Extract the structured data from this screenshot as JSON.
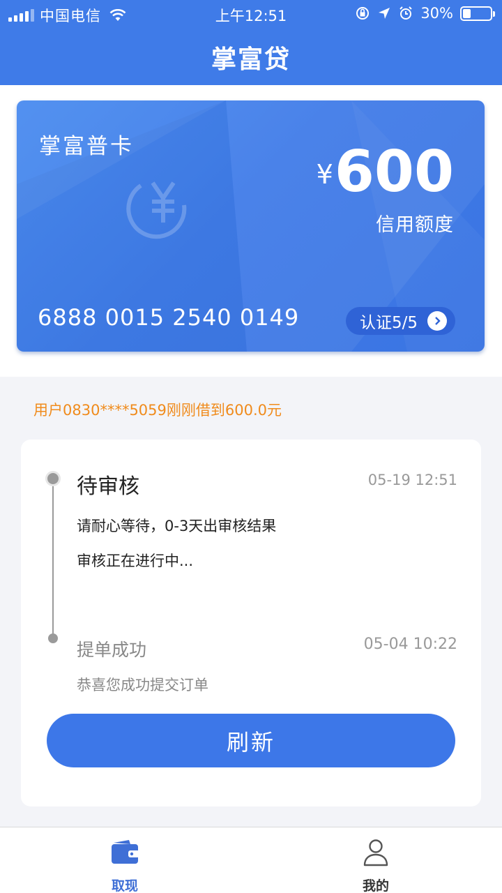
{
  "status_bar": {
    "carrier": "中国电信",
    "time": "上午12:51",
    "battery": "30%",
    "battery_level": 0.3
  },
  "header": {
    "title": "掌富贷"
  },
  "card": {
    "name": "掌富普卡",
    "currency": "¥",
    "amount": "600",
    "amount_label": "信用额度",
    "number": "6888 0015 2540 0149",
    "certification": "认证5/5"
  },
  "notice": "用户0830****5059刚刚借到600.0元",
  "timeline": [
    {
      "title": "待审核",
      "time": "05-19 12:51",
      "desc": [
        "请耐心等待，0-3天出审核结果",
        "审核正在进行中..."
      ]
    },
    {
      "title": "提单成功",
      "time": "05-04 10:22",
      "desc": [
        "恭喜您成功提交订单"
      ]
    }
  ],
  "refresh_label": "刷新",
  "tabs": [
    {
      "label": "取现",
      "icon": "wallet-icon",
      "active": true
    },
    {
      "label": "我的",
      "icon": "user-icon",
      "active": false
    }
  ],
  "colors": {
    "primary": "#3f7be8",
    "notice": "#f08b1c",
    "background": "#f3f4f8"
  }
}
